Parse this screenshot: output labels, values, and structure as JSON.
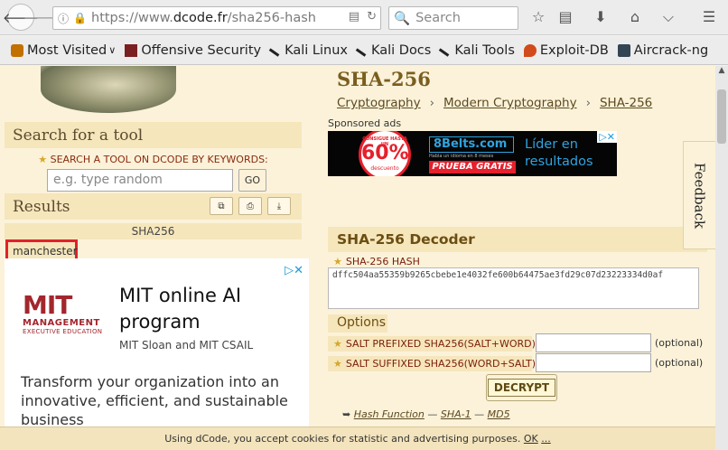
{
  "browser": {
    "url_host_prefix": "https://www.",
    "url_host": "dcode.fr",
    "url_path": "/sha256-hash",
    "search_placeholder": "Search",
    "bookmarks": [
      {
        "label": "Most Visited",
        "icon": "gear-icon",
        "color": "#c27000"
      },
      {
        "label": "Offensive Security",
        "icon": "offsec-icon",
        "color": "#7a2020"
      },
      {
        "label": "Kali Linux",
        "icon": "kali-dragon-icon",
        "color": "#222222"
      },
      {
        "label": "Kali Docs",
        "icon": "kali-dragon-icon",
        "color": "#222222"
      },
      {
        "label": "Kali Tools",
        "icon": "kali-dragon-icon",
        "color": "#222222"
      },
      {
        "label": "Exploit-DB",
        "icon": "exploit-db-icon",
        "color": "#d14a1c"
      },
      {
        "label": "Aircrack-ng",
        "icon": "aircrack-icon",
        "color": "#334455"
      }
    ]
  },
  "left": {
    "search_title": "Search for a tool",
    "keywords_label": "SEARCH A TOOL ON DCODE BY KEYWORDS:",
    "keywords_placeholder": "e.g. type random",
    "go_label": "GO",
    "results_title": "Results",
    "results_header": "SHA256",
    "result_value": "manchester"
  },
  "ad_left": {
    "logo_letters": "MIT",
    "logo_mgmt": "MANAGEMENT",
    "logo_exec": "EXECUTIVE EDUCATION",
    "title": "MIT online AI program",
    "subtitle": "MIT Sloan and MIT CSAIL",
    "body": "Transform your organization into an innovative, efficient, and sustainable business"
  },
  "main": {
    "title": "SHA-256",
    "breadcrumbs": [
      "Cryptography",
      "Modern Cryptography",
      "SHA-256"
    ],
    "sponsored": "Sponsored ads",
    "banner": {
      "circle_top": "CONSIGUE HASTA UN",
      "circle_pct": "60%",
      "circle_bottom": "descuento",
      "logo": "8Belts.com",
      "small": "Habla un idioma en 8 meses",
      "cta": "PRUEBA GRATIS",
      "right_line1": "Líder en",
      "right_line2": "resultados"
    },
    "decoder_title": "SHA-256 Decoder",
    "hash_label": "SHA-256 HASH",
    "hash_value": "dffc504aa55359b9265cbebe1e4032fe600b64475ae3fd29c07d23223334d0af",
    "options_title": "Options",
    "salt_prefixed_label": "SALT PREFIXED SHA256(SALT+WORD)",
    "salt_suffixed_label": "SALT SUFFIXED SHA256(WORD+SALT)",
    "optional_hint": "(optional)",
    "decrypt_label": "DECRYPT",
    "related_prefix": "➥",
    "related_links": [
      "Hash Function",
      "SHA-1",
      "MD5"
    ],
    "feedback_label": "Feedback"
  },
  "cookie": {
    "text": "Using dCode, you accept cookies for statistic and advertising purposes.",
    "ok": "OK",
    "more": "..."
  },
  "colors": {
    "page_bg": "#fbf2d9",
    "section_bg": "#f6e6bc",
    "highlight_border": "#e0212b",
    "title_brown": "#7a5e1f"
  }
}
